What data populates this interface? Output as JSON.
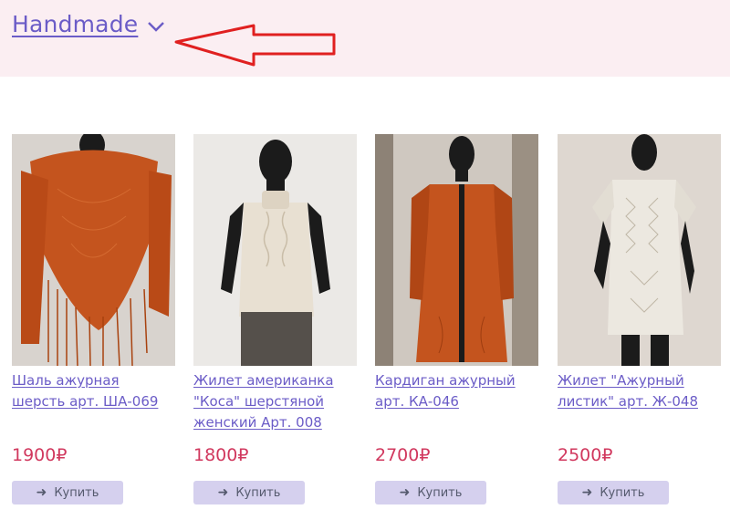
{
  "header": {
    "category_title": "Handmade"
  },
  "products": [
    {
      "name": "Шаль ажурная шерсть арт. ША-069",
      "price": "1900₽",
      "buy_label": "Купить",
      "image": "orange-knit-shawl",
      "color": "#c4541e"
    },
    {
      "name": "Жилет американка \"Коса\" шерстяной женский Арт. 008",
      "price": "1800₽",
      "buy_label": "Купить",
      "image": "cream-cable-vest",
      "color": "#e8e0d2"
    },
    {
      "name": "Кардиган ажурный арт. КА-046",
      "price": "2700₽",
      "buy_label": "Купить",
      "image": "orange-cardigan",
      "color": "#c4541e"
    },
    {
      "name": "Жилет \"Ажурный листик\" арт. Ж-048",
      "price": "2500₽",
      "buy_label": "Купить",
      "image": "white-lace-top",
      "color": "#ece8e0"
    }
  ],
  "colors": {
    "header_bg": "#fbeef2",
    "link": "#6b5cc7",
    "price": "#d1385e",
    "button_bg": "#d5d0ee",
    "annotation_arrow": "#e02020"
  }
}
